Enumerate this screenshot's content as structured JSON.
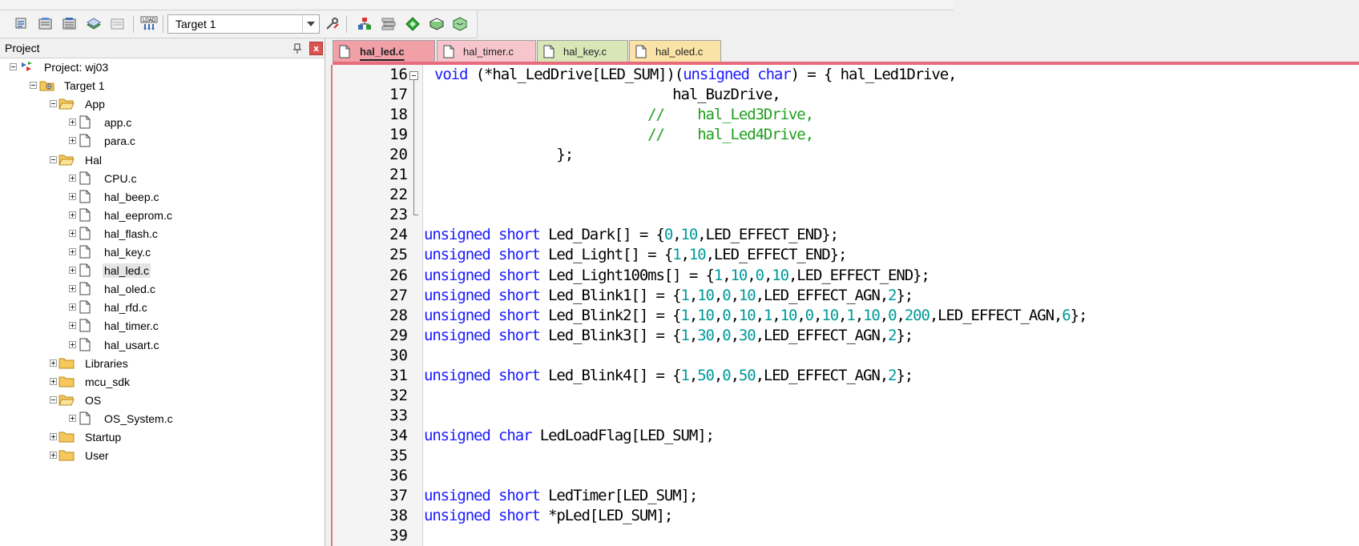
{
  "toolbar": {
    "target_select_value": "Target 1"
  },
  "project_panel": {
    "title": "Project",
    "close_glyph": "x",
    "tree": [
      {
        "label": "Project: wj03",
        "level": 0,
        "kind": "project",
        "expander": "minus"
      },
      {
        "label": "Target 1",
        "level": 1,
        "kind": "target",
        "expander": "minus"
      },
      {
        "label": "App",
        "level": 2,
        "kind": "folder-open",
        "expander": "minus"
      },
      {
        "label": "app.c",
        "level": 3,
        "kind": "file",
        "expander": "plus"
      },
      {
        "label": "para.c",
        "level": 3,
        "kind": "file",
        "expander": "plus"
      },
      {
        "label": "Hal",
        "level": 2,
        "kind": "folder-open",
        "expander": "minus"
      },
      {
        "label": "CPU.c",
        "level": 3,
        "kind": "file",
        "expander": "plus"
      },
      {
        "label": "hal_beep.c",
        "level": 3,
        "kind": "file",
        "expander": "plus"
      },
      {
        "label": "hal_eeprom.c",
        "level": 3,
        "kind": "file",
        "expander": "plus"
      },
      {
        "label": "hal_flash.c",
        "level": 3,
        "kind": "file",
        "expander": "plus"
      },
      {
        "label": "hal_key.c",
        "level": 3,
        "kind": "file",
        "expander": "plus"
      },
      {
        "label": "hal_led.c",
        "level": 3,
        "kind": "file",
        "expander": "plus",
        "selected": true
      },
      {
        "label": "hal_oled.c",
        "level": 3,
        "kind": "file",
        "expander": "plus"
      },
      {
        "label": "hal_rfd.c",
        "level": 3,
        "kind": "file",
        "expander": "plus"
      },
      {
        "label": "hal_timer.c",
        "level": 3,
        "kind": "file",
        "expander": "plus"
      },
      {
        "label": "hal_usart.c",
        "level": 3,
        "kind": "file",
        "expander": "plus"
      },
      {
        "label": "Libraries",
        "level": 2,
        "kind": "folder",
        "expander": "plus"
      },
      {
        "label": "mcu_sdk",
        "level": 2,
        "kind": "folder",
        "expander": "plus"
      },
      {
        "label": "OS",
        "level": 2,
        "kind": "folder-open",
        "expander": "minus"
      },
      {
        "label": "OS_System.c",
        "level": 3,
        "kind": "file",
        "expander": "plus"
      },
      {
        "label": "Startup",
        "level": 2,
        "kind": "folder",
        "expander": "plus"
      },
      {
        "label": "User",
        "level": 2,
        "kind": "folder",
        "expander": "plus"
      }
    ]
  },
  "editor": {
    "tabs": [
      {
        "label": "hal_led.c",
        "active": true,
        "color": "#f2a0a8"
      },
      {
        "label": "hal_timer.c",
        "active": false,
        "color": "#f7c6cc"
      },
      {
        "label": "hal_key.c",
        "active": false,
        "color": "#d8e6b8"
      },
      {
        "label": "hal_oled.c",
        "active": false,
        "color": "#fbe3a8"
      }
    ],
    "lines": [
      {
        "n": "16",
        "tokens": [
          {
            "t": "void",
            "c": "kw"
          },
          {
            "t": " (*hal_LedDrive[LED_SUM])("
          },
          {
            "t": "unsigned char",
            "c": "kw"
          },
          {
            "t": ") = { hal_Led1Drive,"
          }
        ],
        "indent": 1
      },
      {
        "n": "17",
        "tokens": [
          {
            "t": "                              hal_BuzDrive,"
          }
        ]
      },
      {
        "n": "18",
        "tokens": [
          {
            "t": "                           "
          },
          {
            "t": "//    hal_Led3Drive,",
            "c": "cmt"
          }
        ]
      },
      {
        "n": "19",
        "tokens": [
          {
            "t": "                           "
          },
          {
            "t": "//    hal_Led4Drive,",
            "c": "cmt"
          }
        ]
      },
      {
        "n": "20",
        "tokens": [
          {
            "t": "                };"
          }
        ]
      },
      {
        "n": "21",
        "tokens": []
      },
      {
        "n": "22",
        "tokens": []
      },
      {
        "n": "23",
        "tokens": []
      },
      {
        "n": "24",
        "tokens": [
          {
            "t": "unsigned short",
            "c": "kw"
          },
          {
            "t": " Led_Dark[] = {"
          },
          {
            "t": "0",
            "c": "num"
          },
          {
            "t": ","
          },
          {
            "t": "10",
            "c": "num"
          },
          {
            "t": ",LED_EFFECT_END};"
          }
        ]
      },
      {
        "n": "25",
        "tokens": [
          {
            "t": "unsigned short",
            "c": "kw"
          },
          {
            "t": " Led_Light[] = {"
          },
          {
            "t": "1",
            "c": "num"
          },
          {
            "t": ","
          },
          {
            "t": "10",
            "c": "num"
          },
          {
            "t": ",LED_EFFECT_END};"
          }
        ]
      },
      {
        "n": "26",
        "tokens": [
          {
            "t": "unsigned short",
            "c": "kw"
          },
          {
            "t": " Led_Light100ms[] = {"
          },
          {
            "t": "1",
            "c": "num"
          },
          {
            "t": ","
          },
          {
            "t": "10",
            "c": "num"
          },
          {
            "t": ","
          },
          {
            "t": "0",
            "c": "num"
          },
          {
            "t": ","
          },
          {
            "t": "10",
            "c": "num"
          },
          {
            "t": ",LED_EFFECT_END};"
          }
        ]
      },
      {
        "n": "27",
        "tokens": [
          {
            "t": "unsigned short",
            "c": "kw"
          },
          {
            "t": " Led_Blink1[] = {"
          },
          {
            "t": "1",
            "c": "num"
          },
          {
            "t": ","
          },
          {
            "t": "10",
            "c": "num"
          },
          {
            "t": ","
          },
          {
            "t": "0",
            "c": "num"
          },
          {
            "t": ","
          },
          {
            "t": "10",
            "c": "num"
          },
          {
            "t": ",LED_EFFECT_AGN,"
          },
          {
            "t": "2",
            "c": "num"
          },
          {
            "t": "};"
          }
        ]
      },
      {
        "n": "28",
        "tokens": [
          {
            "t": "unsigned short",
            "c": "kw"
          },
          {
            "t": " Led_Blink2[] = {"
          },
          {
            "t": "1",
            "c": "num"
          },
          {
            "t": ","
          },
          {
            "t": "10",
            "c": "num"
          },
          {
            "t": ","
          },
          {
            "t": "0",
            "c": "num"
          },
          {
            "t": ","
          },
          {
            "t": "10",
            "c": "num"
          },
          {
            "t": ","
          },
          {
            "t": "1",
            "c": "num"
          },
          {
            "t": ","
          },
          {
            "t": "10",
            "c": "num"
          },
          {
            "t": ","
          },
          {
            "t": "0",
            "c": "num"
          },
          {
            "t": ","
          },
          {
            "t": "10",
            "c": "num"
          },
          {
            "t": ","
          },
          {
            "t": "1",
            "c": "num"
          },
          {
            "t": ","
          },
          {
            "t": "10",
            "c": "num"
          },
          {
            "t": ","
          },
          {
            "t": "0",
            "c": "num"
          },
          {
            "t": ","
          },
          {
            "t": "200",
            "c": "num"
          },
          {
            "t": ",LED_EFFECT_AGN,"
          },
          {
            "t": "6",
            "c": "num"
          },
          {
            "t": "};"
          }
        ]
      },
      {
        "n": "29",
        "tokens": [
          {
            "t": "unsigned short",
            "c": "kw"
          },
          {
            "t": " Led_Blink3[] = {"
          },
          {
            "t": "1",
            "c": "num"
          },
          {
            "t": ","
          },
          {
            "t": "30",
            "c": "num"
          },
          {
            "t": ","
          },
          {
            "t": "0",
            "c": "num"
          },
          {
            "t": ","
          },
          {
            "t": "30",
            "c": "num"
          },
          {
            "t": ",LED_EFFECT_AGN,"
          },
          {
            "t": "2",
            "c": "num"
          },
          {
            "t": "};"
          }
        ]
      },
      {
        "n": "30",
        "tokens": []
      },
      {
        "n": "31",
        "tokens": [
          {
            "t": "unsigned short",
            "c": "kw"
          },
          {
            "t": " Led_Blink4[] = {"
          },
          {
            "t": "1",
            "c": "num"
          },
          {
            "t": ","
          },
          {
            "t": "50",
            "c": "num"
          },
          {
            "t": ","
          },
          {
            "t": "0",
            "c": "num"
          },
          {
            "t": ","
          },
          {
            "t": "50",
            "c": "num"
          },
          {
            "t": ",LED_EFFECT_AGN,"
          },
          {
            "t": "2",
            "c": "num"
          },
          {
            "t": "};"
          }
        ]
      },
      {
        "n": "32",
        "tokens": []
      },
      {
        "n": "33",
        "tokens": []
      },
      {
        "n": "34",
        "tokens": [
          {
            "t": "unsigned char",
            "c": "kw"
          },
          {
            "t": " LedLoadFlag[LED_SUM];"
          }
        ]
      },
      {
        "n": "35",
        "tokens": []
      },
      {
        "n": "36",
        "tokens": []
      },
      {
        "n": "37",
        "tokens": [
          {
            "t": "unsigned short",
            "c": "kw"
          },
          {
            "t": " LedTimer[LED_SUM];"
          }
        ]
      },
      {
        "n": "38",
        "tokens": [
          {
            "t": "unsigned short",
            "c": "kw"
          },
          {
            "t": " *pLed[LED_SUM];"
          }
        ]
      },
      {
        "n": "39",
        "tokens": []
      }
    ]
  }
}
